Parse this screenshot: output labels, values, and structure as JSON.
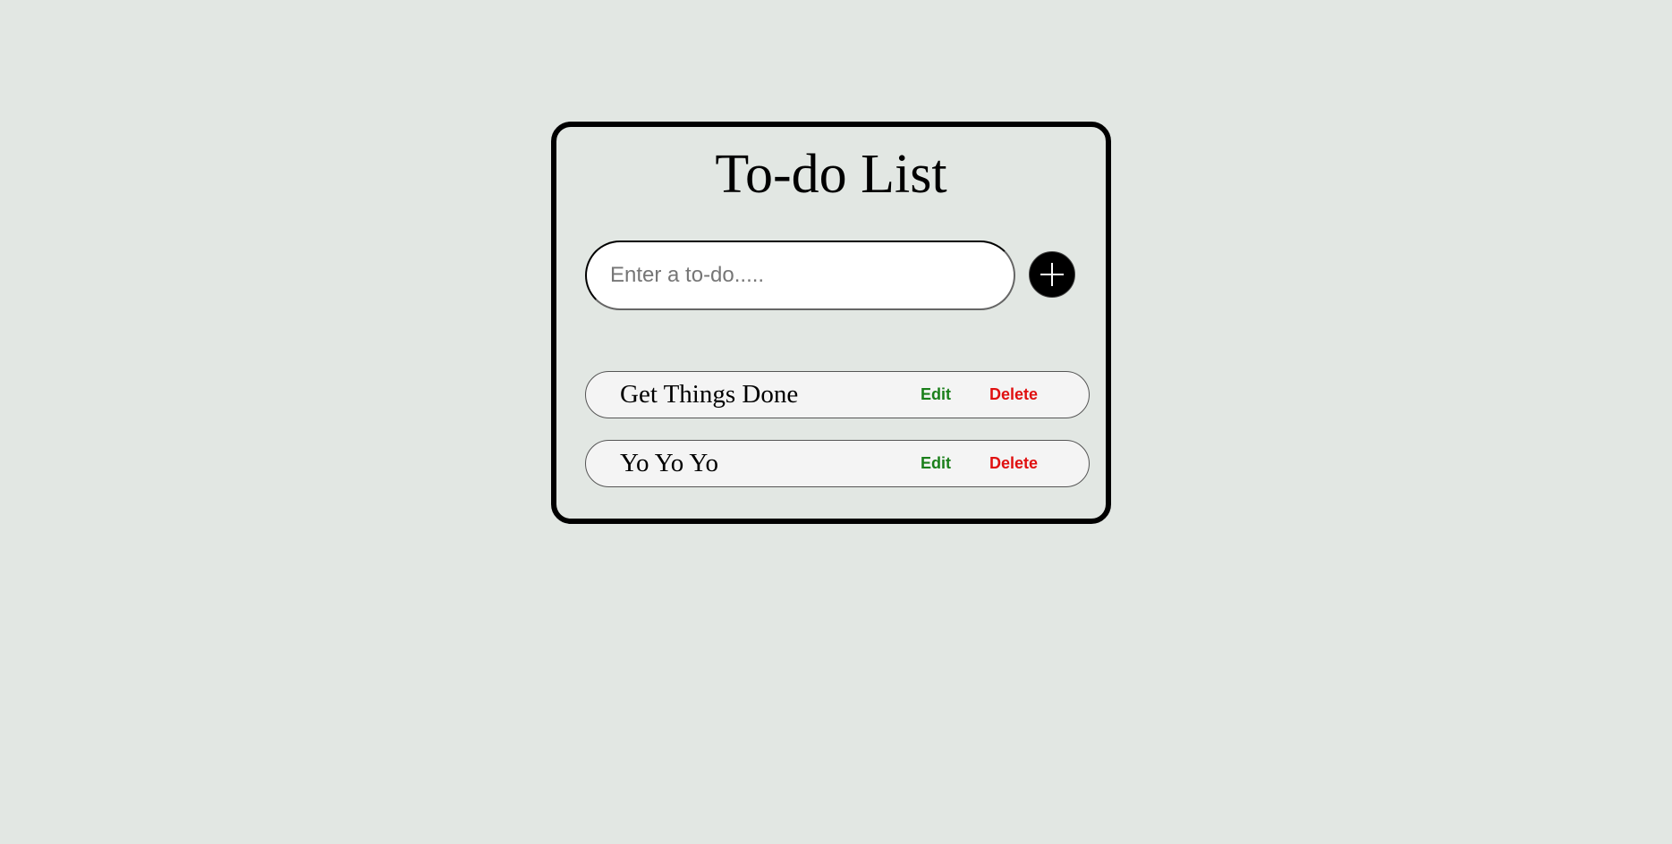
{
  "app": {
    "title": "To-do List"
  },
  "input": {
    "placeholder": "Enter a to-do.....",
    "value": ""
  },
  "add_button": {
    "icon": "plus-icon"
  },
  "todos": [
    {
      "text": "Get Things Done",
      "edit_label": "Edit",
      "delete_label": "Delete"
    },
    {
      "text": "Yo Yo Yo",
      "edit_label": "Edit",
      "delete_label": "Delete"
    }
  ],
  "colors": {
    "background": "#e2e7e3",
    "edit": "#1a7f1a",
    "delete": "#e01010",
    "accent": "#000000"
  }
}
